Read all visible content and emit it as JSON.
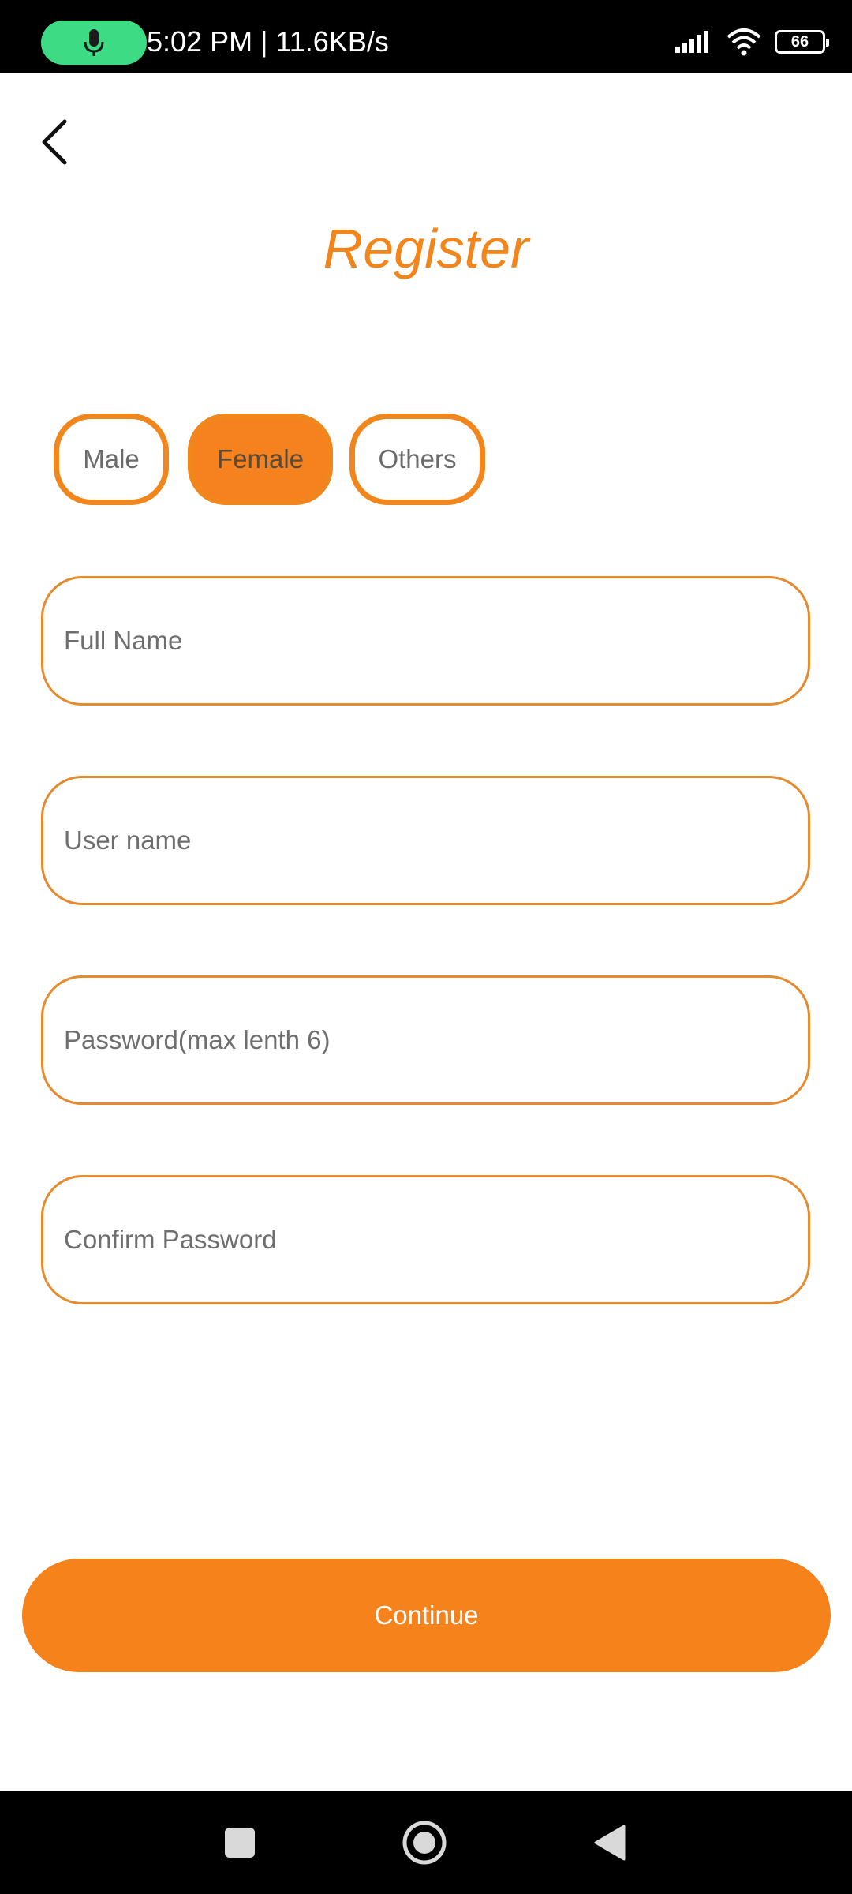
{
  "status_bar": {
    "time_speed": "5:02 PM | 11.6KB/s",
    "battery": "66"
  },
  "header": {
    "title": "Register"
  },
  "gender": {
    "options": [
      "Male",
      "Female",
      "Others"
    ],
    "selected": "Female"
  },
  "form": {
    "full_name_placeholder": "Full Name",
    "username_placeholder": "User name",
    "password_placeholder": "Password(max lenth 6)",
    "confirm_password_placeholder": "Confirm Password"
  },
  "actions": {
    "continue_label": "Continue"
  },
  "colors": {
    "accent": "#f5821f",
    "border": "#e68a2e",
    "title": "#f0861c"
  }
}
